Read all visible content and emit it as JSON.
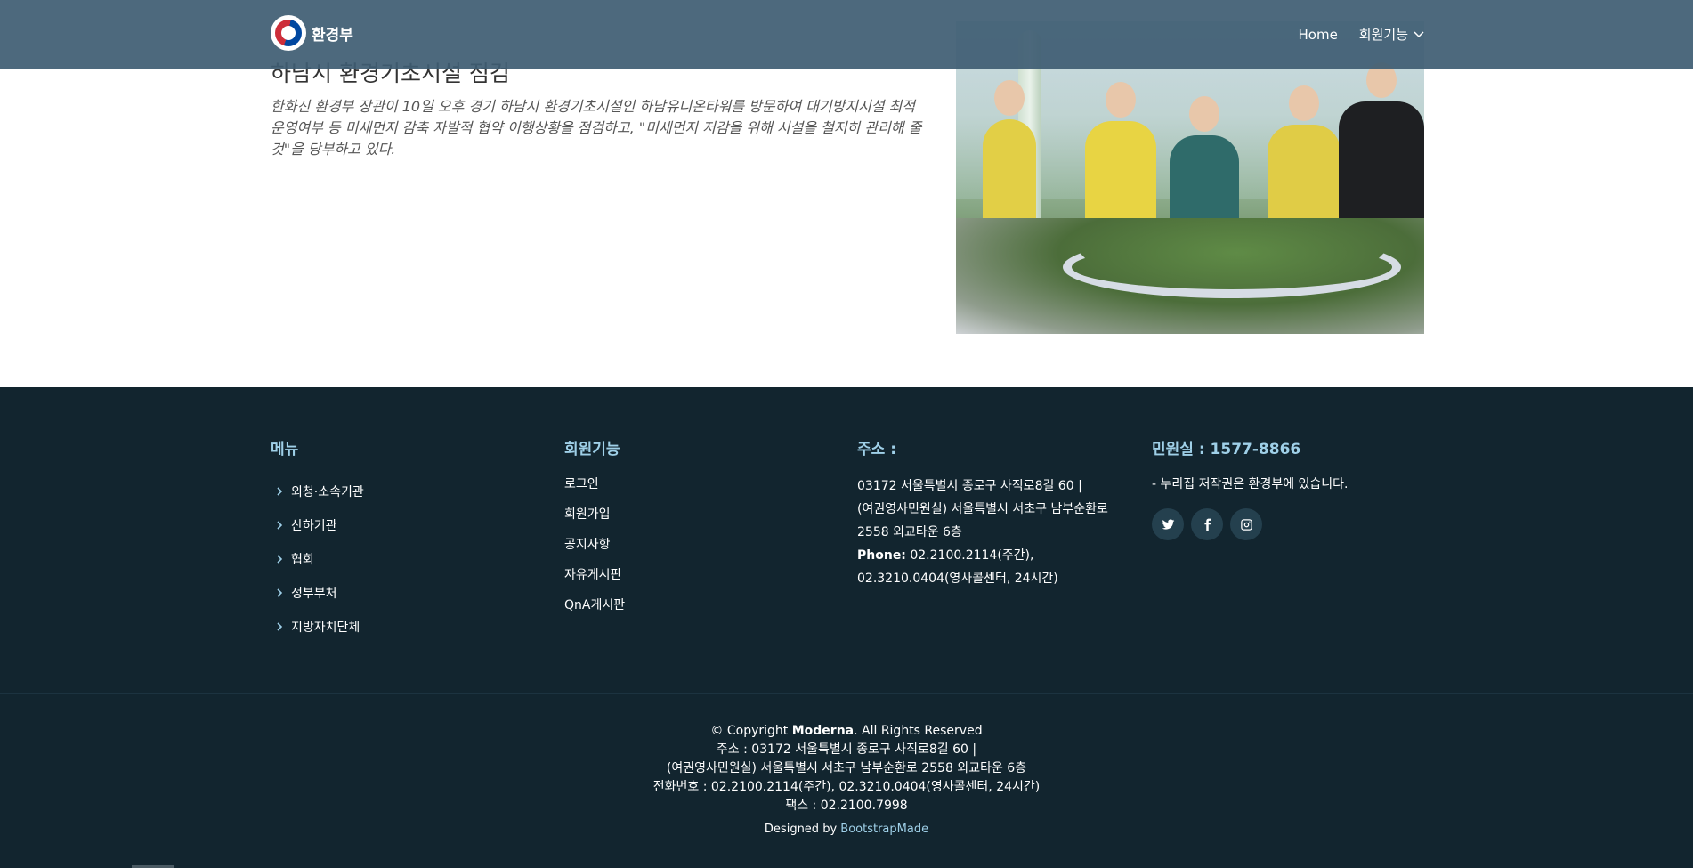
{
  "header": {
    "logo_text": "환경부",
    "nav": [
      {
        "label": "Home"
      },
      {
        "label": "회원기능"
      }
    ]
  },
  "article": {
    "title": "하남시 환경기초시설 점검",
    "description": "한화진 환경부 장관이 10일 오후 경기 하남시 환경기초시설인 하남유니온타워를 방문하여 대기방지시설 최적 운영여부 등 미세먼지 감축 자발적 협약 이행상황을 점검하고, \"미세먼지 저감을 위해 시설을 철저히 관리해 줄 것\"을 당부하고 있다."
  },
  "footer": {
    "menu": {
      "title": "메뉴",
      "items": [
        "외청·소속기관",
        "산하기관",
        "협회",
        "정부부처",
        "지방자치단체"
      ]
    },
    "member": {
      "title": "회원기능",
      "items": [
        "로그인",
        "회원가입",
        "공지사항",
        "자유게시판",
        "QnA게시판"
      ]
    },
    "address": {
      "title": "주소 :",
      "line1": "03172 서울특별시 종로구 사직로8길 60 |",
      "line2": "(여권영사민원실) 서울특별시 서초구 남부순환로",
      "line3": "2558 외교타운 6층",
      "phone_label": "Phone:",
      "phone_value": "02.2100.2114(주간),",
      "line5": "02.3210.0404(영사콜센터, 24시간)"
    },
    "civil": {
      "title": "민원실 : 1577-8866",
      "text": "- 누리집 저작권은 환경부에 있습니다.",
      "socials": [
        "twitter-icon",
        "facebook-icon",
        "instagram-icon"
      ]
    },
    "bottom": {
      "copyright_prefix": "© Copyright",
      "copyright_brand": "Moderna",
      "copyright_suffix": ". All Rights Reserved",
      "addr1": "주소 : 03172 서울특별시 종로구 사직로8길 60 |",
      "addr2": "(여권영사민원실) 서울특별시 서초구 남부순환로 2558 외교타운 6층",
      "tel": "전화번호 : 02.2100.2114(주간), 02.3210.0404(영사콜센터, 24시간)",
      "fax": "팩스 : 02.2100.7998",
      "designed_by": "Designed by",
      "designer": "BootstrapMade"
    }
  },
  "colors": {
    "header_bg": "#3e5c72",
    "footer_bg": "#12252f",
    "accent": "#9fd0e8"
  }
}
